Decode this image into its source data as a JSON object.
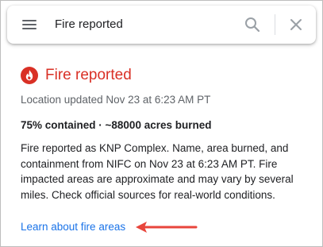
{
  "search": {
    "query": "Fire reported",
    "menu_icon": "hamburger-menu-icon",
    "search_icon": "magnifier-icon",
    "close_icon": "close-x-icon"
  },
  "card": {
    "title": "Fire reported",
    "title_icon": "fire-icon",
    "location_updated": "Location updated Nov 23 at 6:23 AM PT",
    "stats": "75% contained · ~88000 acres burned",
    "description": "Fire reported as KNP Complex. Name, area burned, and containment from NIFC on Nov 23 at 6:23 AM PT. Fire impacted areas are approximate and may vary by several miles. Check official sources for real-world conditions.",
    "learn_link": "Learn about fire areas"
  },
  "colors": {
    "alert_red": "#d93025",
    "link_blue": "#1a73e8",
    "annotation_arrow": "#e8453c",
    "secondary_text": "#5f6368"
  }
}
